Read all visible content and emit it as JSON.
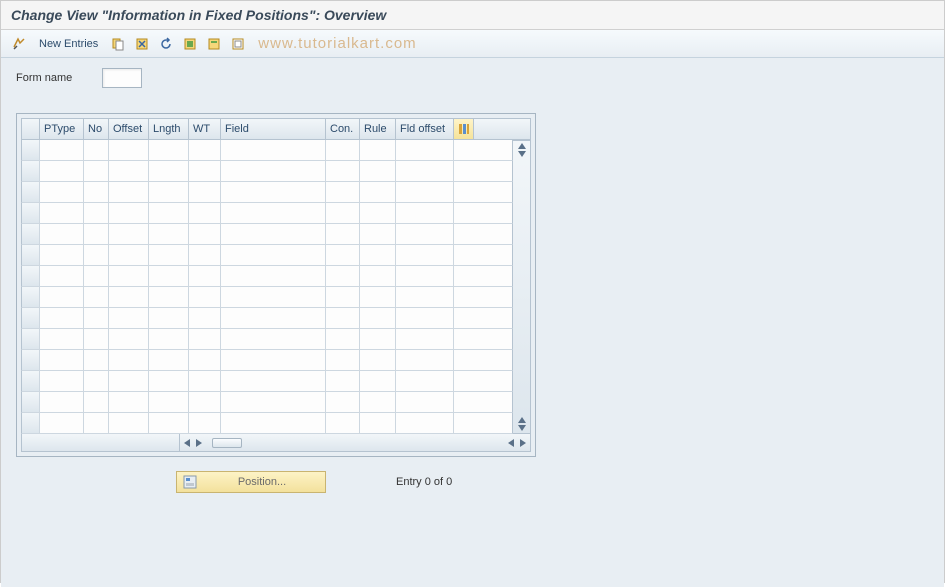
{
  "title": "Change View \"Information in Fixed Positions\": Overview",
  "toolbar": {
    "new_entries": "New Entries"
  },
  "watermark": "www.tutorialkart.com",
  "form": {
    "name_label": "Form name",
    "name_value": ""
  },
  "grid": {
    "columns": [
      "PType",
      "No",
      "Offset",
      "Lngth",
      "WT",
      "Field",
      "Con.",
      "Rule",
      "Fld offset"
    ],
    "row_count": 14
  },
  "footer": {
    "position_label": "Position...",
    "entry_text": "Entry 0 of 0"
  }
}
